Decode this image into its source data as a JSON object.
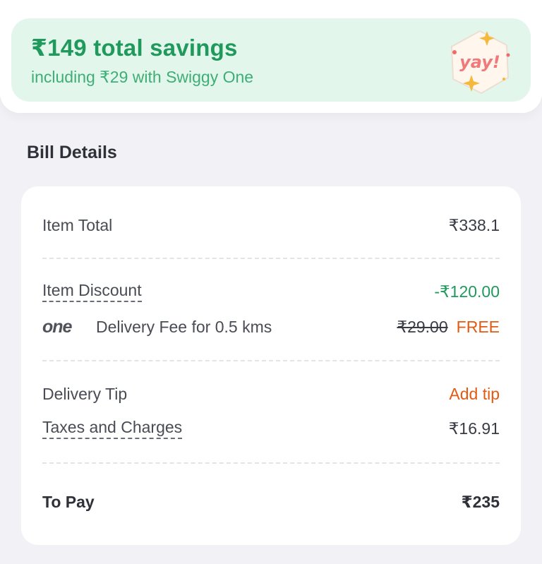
{
  "savings": {
    "title": "₹149 total savings",
    "subtitle": "including ₹29 with Swiggy One",
    "badge_text": "yay!",
    "bg_color": "#e3f6ec",
    "accent_color": "#1f9a5c"
  },
  "bill": {
    "section_title": "Bill Details",
    "item_total": {
      "label": "Item Total",
      "value": "₹338.1"
    },
    "item_discount": {
      "label": "Item Discount",
      "value": "-₹120.00"
    },
    "delivery_fee": {
      "logo": "one",
      "label": "Delivery Fee for 0.5 kms",
      "original": "₹29.00",
      "value": "FREE"
    },
    "delivery_tip": {
      "label": "Delivery Tip",
      "action": "Add tip"
    },
    "taxes": {
      "label": "Taxes and Charges",
      "value": "₹16.91"
    },
    "to_pay": {
      "label": "To Pay",
      "value": "₹235"
    }
  },
  "colors": {
    "discount_green": "#1f9a5c",
    "action_orange": "#e35a12",
    "page_bg": "#f1f1f6"
  }
}
